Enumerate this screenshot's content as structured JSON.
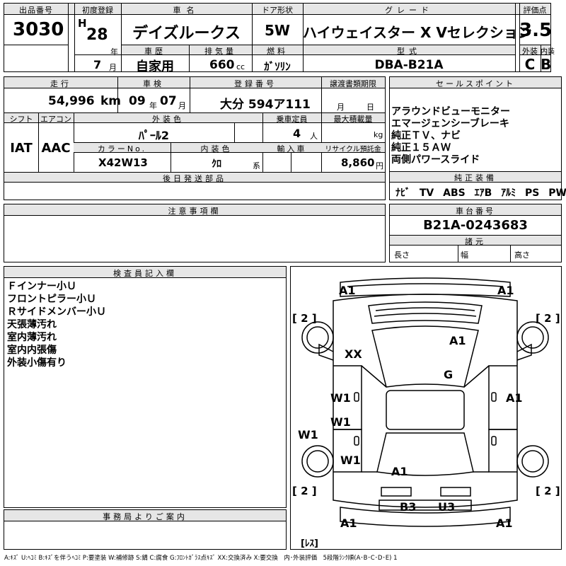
{
  "lot": {
    "header": "出品番号",
    "value": "3030"
  },
  "first_reg": {
    "header": "初度登録",
    "era": "H",
    "year": "28",
    "year_unit": "年",
    "month": "7",
    "month_unit": "月"
  },
  "car_name": {
    "header": "車名",
    "value": "デイズルークス"
  },
  "door": {
    "header": "ドア形状",
    "value": "5W"
  },
  "grade": {
    "header": "グレード",
    "value": "ハイウェイスター X Vセレクション"
  },
  "score": {
    "header": "評価点",
    "value": "3.5",
    "ext_header": "外装",
    "int_header": "内装",
    "ext": "C",
    "int": "B"
  },
  "history": {
    "header": "車歴",
    "value": "自家用"
  },
  "displacement": {
    "header": "排気量",
    "value": "660",
    "unit": "cc"
  },
  "fuel": {
    "header": "燃料",
    "value": "ｶﾞｿﾘﾝ"
  },
  "model": {
    "header": "型式",
    "value": "DBA-B21A"
  },
  "mileage": {
    "header": "走行",
    "value": "54,996",
    "unit": "km"
  },
  "inspection": {
    "header": "車検",
    "year": "09",
    "year_unit": "年",
    "month": "07",
    "month_unit": "月"
  },
  "plate": {
    "header": "登録番号",
    "value": "大分 594ア111"
  },
  "transfer": {
    "header": "譲渡書類期限",
    "month_unit": "月",
    "day_unit": "日"
  },
  "shift": {
    "header": "シフト",
    "value": "IAT"
  },
  "aircon": {
    "header": "エアコン",
    "value": "AAC"
  },
  "ext_color": {
    "header": "外装色",
    "value": "ﾊﾟｰﾙ2"
  },
  "capacity": {
    "header": "乗車定員",
    "value": "4",
    "unit": "人"
  },
  "max_load": {
    "header": "最大積載量",
    "unit": "kg"
  },
  "color_no": {
    "header": "カラーNo.",
    "value": "X42W13"
  },
  "int_color": {
    "header": "内装色",
    "value": "ｸﾛ",
    "unit": "系"
  },
  "import": {
    "header": "輸入車"
  },
  "recycle": {
    "header": "リサイクル預託金",
    "value": "8,860",
    "unit": "円"
  },
  "later_parts": {
    "header": "後日発送部品"
  },
  "sales_points": {
    "header": "セールスポイント",
    "lines": [
      "アラウンドビューモニター",
      "エマージェンシーブレーキ",
      "純正ＴＶ、ナビ",
      "純正１５ＡＷ",
      "両側パワースライド"
    ]
  },
  "equipment": {
    "header": "純正装備",
    "items": [
      "ﾅﾋﾞ",
      "TV",
      "ABS",
      "ｴｱB",
      "ｱﾙﾐ",
      "PS",
      "PW"
    ]
  },
  "notes": {
    "header": "注意事項欄"
  },
  "chassis": {
    "header": "車台番号",
    "value": "B21A-0243683"
  },
  "specs": {
    "header": "諸元",
    "length": "長さ",
    "width": "幅",
    "height": "高さ"
  },
  "inspector": {
    "header": "検査員記入欄",
    "lines": [
      "Ｆインナー小Ｕ",
      "フロントピラー小Ｕ",
      "Ｒサイドメンバー小Ｕ",
      "天張薄汚れ",
      "室内薄汚れ",
      "室内内張傷",
      "外装小傷有り"
    ]
  },
  "office": {
    "header": "事務局よりご案内"
  },
  "diagram": {
    "labels": {
      "a1_tl": "A1",
      "a1_tr": "A1",
      "tire_tl": "[ 2 ]",
      "tire_tr": "[ 2 ]",
      "xx": "XX",
      "a1_roof": "A1",
      "g": "G",
      "w1_l1": "W1",
      "w1_l2": "W1",
      "w1_l3": "W1",
      "w1_l4": "W1",
      "a1_rdoor": "A1",
      "a1_tail": "A1",
      "tire_bl": "[ 2 ]",
      "tire_br": "[ 2 ]",
      "b3": "B3",
      "u3": "U3",
      "a1_bl": "A1",
      "a1_br": "A1",
      "res": "[ﾚｽ]"
    }
  },
  "legend": "A:ｷｽﾞ U:ﾍｺﾐ B:ｷｽﾞを伴うﾍｺﾐ P:要塗装 W:補修跡 S:錆 C:腐食 G:ﾌﾛﾝﾄｶﾞﾗｽ点ｷｽﾞ XX:交換済み X:要交換　内･外装評価　5段階ﾗﾝｸ順(A･B･C･D･E) 1"
}
